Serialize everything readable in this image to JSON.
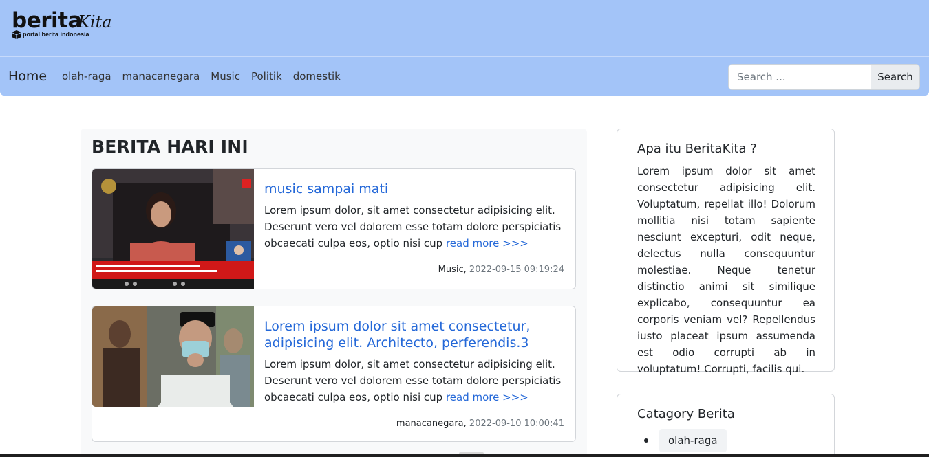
{
  "brand": {
    "name_bold": "berita",
    "name_script": "Kita",
    "tagline": "portal berita indonesia"
  },
  "nav": {
    "home": "Home",
    "links": [
      "olah-raga",
      "manacanegara",
      "Music",
      "Politik",
      "domestik"
    ]
  },
  "search": {
    "placeholder": "Search ...",
    "button": "Search"
  },
  "main": {
    "title": "BERITA HARI INI",
    "articles": [
      {
        "title": "music sampai mati",
        "excerpt": "Lorem ipsum dolor, sit amet consectetur adipisicing elit. Deserunt vero vel dolorem esse totam dolore perspiciatis obcaecati culpa eos, optio nisi cup",
        "read_more": "read more >>>",
        "category": "Music,",
        "date": "2022-09-15 09:19:24",
        "image": "photo-woman-speaking-parliament-broadcast"
      },
      {
        "title": "Lorem ipsum dolor sit amet consectetur, adipisicing elit. Architecto, perferendis.3",
        "excerpt": "Lorem ipsum dolor, sit amet consectetur adipisicing elit. Deserunt vero vel dolorem esse totam dolore perspiciatis obcaecati culpa eos, optio nisi cup",
        "read_more": "read more >>>",
        "category": "manacanegara,",
        "date": "2022-09-10 10:00:41",
        "image": "photo-man-with-mask-and-cap"
      }
    ]
  },
  "sidebar": {
    "about_title": "Apa itu BeritaKita ?",
    "about_text": "Lorem ipsum dolor sit amet consectetur adipisicing elit. Voluptatum, repellat illo! Dolorum mollitia nisi totam sapiente nesciunt excepturi, odit neque, delectus nulla consequuntur molestiae. Neque tenetur distinctio animi sit similique explicabo, consequuntur ea corporis veniam vel? Repellendus iusto placeat ipsum assumenda est odio corrupti ab in voluptatum! Corrupti, facilis qui.",
    "category_title": "Catagory Berita",
    "categories": [
      "olah-raga"
    ]
  },
  "colors": {
    "header_bg": "#a3c4f8",
    "link": "#2468d8",
    "panel_bg": "#f8f9fa"
  }
}
